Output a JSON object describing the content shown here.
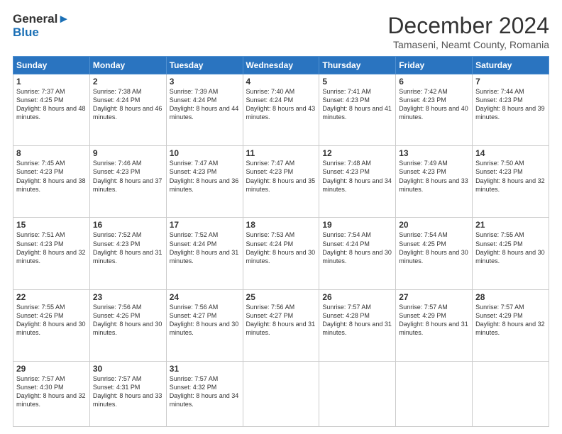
{
  "header": {
    "logo_line1": "General",
    "logo_line2": "Blue",
    "month": "December 2024",
    "location": "Tamaseni, Neamt County, Romania"
  },
  "weekdays": [
    "Sunday",
    "Monday",
    "Tuesday",
    "Wednesday",
    "Thursday",
    "Friday",
    "Saturday"
  ],
  "weeks": [
    [
      {
        "day": "1",
        "sunrise": "7:37 AM",
        "sunset": "4:25 PM",
        "daylight": "8 hours and 48 minutes."
      },
      {
        "day": "2",
        "sunrise": "7:38 AM",
        "sunset": "4:24 PM",
        "daylight": "8 hours and 46 minutes."
      },
      {
        "day": "3",
        "sunrise": "7:39 AM",
        "sunset": "4:24 PM",
        "daylight": "8 hours and 44 minutes."
      },
      {
        "day": "4",
        "sunrise": "7:40 AM",
        "sunset": "4:24 PM",
        "daylight": "8 hours and 43 minutes."
      },
      {
        "day": "5",
        "sunrise": "7:41 AM",
        "sunset": "4:23 PM",
        "daylight": "8 hours and 41 minutes."
      },
      {
        "day": "6",
        "sunrise": "7:42 AM",
        "sunset": "4:23 PM",
        "daylight": "8 hours and 40 minutes."
      },
      {
        "day": "7",
        "sunrise": "7:44 AM",
        "sunset": "4:23 PM",
        "daylight": "8 hours and 39 minutes."
      }
    ],
    [
      {
        "day": "8",
        "sunrise": "7:45 AM",
        "sunset": "4:23 PM",
        "daylight": "8 hours and 38 minutes."
      },
      {
        "day": "9",
        "sunrise": "7:46 AM",
        "sunset": "4:23 PM",
        "daylight": "8 hours and 37 minutes."
      },
      {
        "day": "10",
        "sunrise": "7:47 AM",
        "sunset": "4:23 PM",
        "daylight": "8 hours and 36 minutes."
      },
      {
        "day": "11",
        "sunrise": "7:47 AM",
        "sunset": "4:23 PM",
        "daylight": "8 hours and 35 minutes."
      },
      {
        "day": "12",
        "sunrise": "7:48 AM",
        "sunset": "4:23 PM",
        "daylight": "8 hours and 34 minutes."
      },
      {
        "day": "13",
        "sunrise": "7:49 AM",
        "sunset": "4:23 PM",
        "daylight": "8 hours and 33 minutes."
      },
      {
        "day": "14",
        "sunrise": "7:50 AM",
        "sunset": "4:23 PM",
        "daylight": "8 hours and 32 minutes."
      }
    ],
    [
      {
        "day": "15",
        "sunrise": "7:51 AM",
        "sunset": "4:23 PM",
        "daylight": "8 hours and 32 minutes."
      },
      {
        "day": "16",
        "sunrise": "7:52 AM",
        "sunset": "4:23 PM",
        "daylight": "8 hours and 31 minutes."
      },
      {
        "day": "17",
        "sunrise": "7:52 AM",
        "sunset": "4:24 PM",
        "daylight": "8 hours and 31 minutes."
      },
      {
        "day": "18",
        "sunrise": "7:53 AM",
        "sunset": "4:24 PM",
        "daylight": "8 hours and 30 minutes."
      },
      {
        "day": "19",
        "sunrise": "7:54 AM",
        "sunset": "4:24 PM",
        "daylight": "8 hours and 30 minutes."
      },
      {
        "day": "20",
        "sunrise": "7:54 AM",
        "sunset": "4:25 PM",
        "daylight": "8 hours and 30 minutes."
      },
      {
        "day": "21",
        "sunrise": "7:55 AM",
        "sunset": "4:25 PM",
        "daylight": "8 hours and 30 minutes."
      }
    ],
    [
      {
        "day": "22",
        "sunrise": "7:55 AM",
        "sunset": "4:26 PM",
        "daylight": "8 hours and 30 minutes."
      },
      {
        "day": "23",
        "sunrise": "7:56 AM",
        "sunset": "4:26 PM",
        "daylight": "8 hours and 30 minutes."
      },
      {
        "day": "24",
        "sunrise": "7:56 AM",
        "sunset": "4:27 PM",
        "daylight": "8 hours and 30 minutes."
      },
      {
        "day": "25",
        "sunrise": "7:56 AM",
        "sunset": "4:27 PM",
        "daylight": "8 hours and 31 minutes."
      },
      {
        "day": "26",
        "sunrise": "7:57 AM",
        "sunset": "4:28 PM",
        "daylight": "8 hours and 31 minutes."
      },
      {
        "day": "27",
        "sunrise": "7:57 AM",
        "sunset": "4:29 PM",
        "daylight": "8 hours and 31 minutes."
      },
      {
        "day": "28",
        "sunrise": "7:57 AM",
        "sunset": "4:29 PM",
        "daylight": "8 hours and 32 minutes."
      }
    ],
    [
      {
        "day": "29",
        "sunrise": "7:57 AM",
        "sunset": "4:30 PM",
        "daylight": "8 hours and 32 minutes."
      },
      {
        "day": "30",
        "sunrise": "7:57 AM",
        "sunset": "4:31 PM",
        "daylight": "8 hours and 33 minutes."
      },
      {
        "day": "31",
        "sunrise": "7:57 AM",
        "sunset": "4:32 PM",
        "daylight": "8 hours and 34 minutes."
      },
      null,
      null,
      null,
      null
    ]
  ]
}
